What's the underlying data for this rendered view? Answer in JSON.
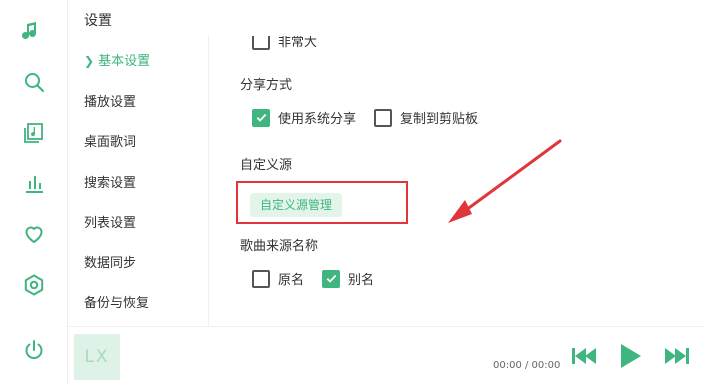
{
  "window": {
    "title": "设置"
  },
  "rail": {
    "icons": [
      "music-note-icon",
      "search-icon",
      "playlist-icon",
      "chart-icon",
      "heart-icon",
      "settings-icon",
      "power-icon"
    ],
    "accent": "#3fb57f"
  },
  "nav": {
    "items": [
      {
        "label": "基本设置",
        "active": true
      },
      {
        "label": "播放设置",
        "active": false
      },
      {
        "label": "桌面歌词",
        "active": false
      },
      {
        "label": "搜索设置",
        "active": false
      },
      {
        "label": "列表设置",
        "active": false
      },
      {
        "label": "数据同步",
        "active": false
      },
      {
        "label": "备份与恢复",
        "active": false
      }
    ]
  },
  "content": {
    "partial_option": {
      "label": "非常大",
      "checked": false
    },
    "share": {
      "title": "分享方式",
      "options": [
        {
          "label": "使用系统分享",
          "checked": true
        },
        {
          "label": "复制到剪贴板",
          "checked": false
        }
      ]
    },
    "custom_source": {
      "title": "自定义源",
      "button_label": "自定义源管理"
    },
    "source_name": {
      "title": "歌曲来源名称",
      "options": [
        {
          "label": "原名",
          "checked": false
        },
        {
          "label": "别名",
          "checked": true
        }
      ]
    }
  },
  "player": {
    "cover_text": "LX",
    "time": "00:00 / 00:00"
  },
  "colors": {
    "accent": "#3fb57f",
    "highlight": "#e0353a"
  }
}
